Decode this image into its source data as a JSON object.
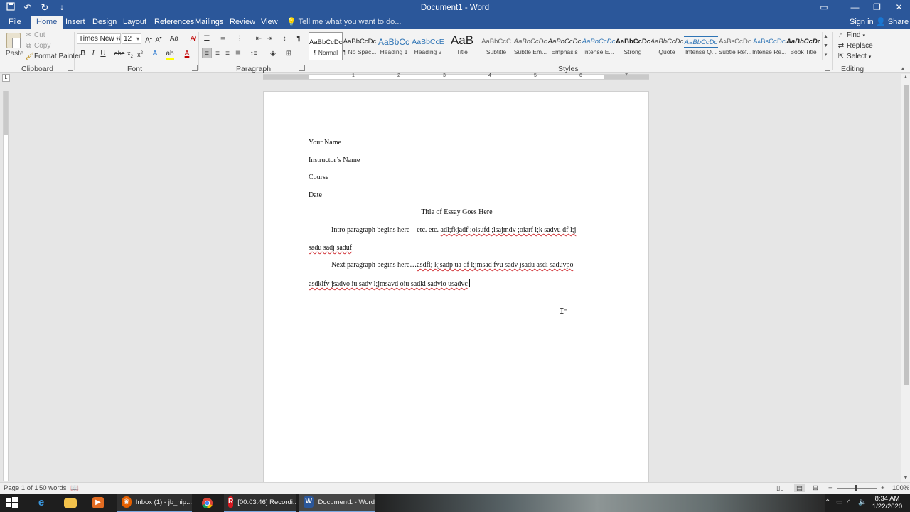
{
  "window": {
    "title": "Document1 - Word",
    "controls": {
      "ribbon_options": "▭",
      "minimize": "—",
      "restore": "❐",
      "close": "✕"
    }
  },
  "qat": {
    "save_icon": "save-icon",
    "undo_icon": "undo-icon",
    "redo_icon": "redo-icon",
    "customize_icon": "customize-qat-icon"
  },
  "tabs": [
    "File",
    "Home",
    "Insert",
    "Design",
    "Layout",
    "References",
    "Mailings",
    "Review",
    "View"
  ],
  "tell_me": "Tell me what you want to do...",
  "account": {
    "signin": "Sign in",
    "share": "Share"
  },
  "ribbon": {
    "clipboard": {
      "label": "Clipboard",
      "paste": "Paste",
      "cut": "Cut",
      "copy": "Copy",
      "format_painter": "Format Painter"
    },
    "font": {
      "label": "Font",
      "font_name": "Times New Ro",
      "font_size": "12"
    },
    "paragraph": {
      "label": "Paragraph"
    },
    "styles": {
      "label": "Styles",
      "items": [
        {
          "sample": "AaBbCcDc",
          "name": "¶ Normal"
        },
        {
          "sample": "AaBbCcDc",
          "name": "¶ No Spac..."
        },
        {
          "sample": "AaBbCc",
          "name": "Heading 1"
        },
        {
          "sample": "AaBbCcE",
          "name": "Heading 2"
        },
        {
          "sample": "AaB",
          "name": "Title"
        },
        {
          "sample": "AaBbCcC",
          "name": "Subtitle"
        },
        {
          "sample": "AaBbCcDc",
          "name": "Subtle Em..."
        },
        {
          "sample": "AaBbCcDc",
          "name": "Emphasis"
        },
        {
          "sample": "AaBbCcDc",
          "name": "Intense E..."
        },
        {
          "sample": "AaBbCcDc",
          "name": "Strong"
        },
        {
          "sample": "AaBbCcDc",
          "name": "Quote"
        },
        {
          "sample": "AaBbCcDc",
          "name": "Intense Q..."
        },
        {
          "sample": "AaBbCcDc",
          "name": "Subtle Ref..."
        },
        {
          "sample": "AaBbCcDc",
          "name": "Intense Re..."
        },
        {
          "sample": "AaBbCcDc",
          "name": "Book Title"
        }
      ]
    },
    "editing": {
      "label": "Editing",
      "find": "Find",
      "replace": "Replace",
      "select": "Select"
    }
  },
  "ruler_numbers": [
    "1",
    "2",
    "3",
    "4",
    "5",
    "6",
    "7"
  ],
  "document": {
    "lines": {
      "name": "Your Name",
      "instructor": "Instructor’s Name",
      "course": "Course",
      "date": "Date",
      "title": "Title of Essay Goes Here",
      "p1_a_plain": "Intro paragraph begins here – etc. etc. ",
      "p1_a_squiggle": "adl;fkjadf ;oisufd ;lsajmdv ;oiarf l;k sadvu df l;j",
      "p1_b": "sadu sadj saduf",
      "p2_a_plain": "Next paragraph begins here…",
      "p2_a_squiggle": "asdfl; kjsadp ua df l;jmsad fvu sadv jsadu asdi saduvpo",
      "p2_b": "asdklfv jsadvo iu sadv l;jmsavd oiu sadki sadvio usadvc"
    }
  },
  "status": {
    "page": "Page 1 of 1",
    "words": "50 words",
    "zoom": "100%"
  },
  "taskbar": {
    "apps": [
      {
        "label": "Inbox (1) - jb_hip..."
      },
      {
        "label": "[00:03:46] Recordi..."
      },
      {
        "label": "Document1 - Word"
      }
    ],
    "clock_time": "8:34 AM",
    "clock_date": "1/22/2020"
  },
  "colors": {
    "word_blue": "#2b579a",
    "spell_red": "#d13438",
    "font_color_red": "#c00000"
  }
}
